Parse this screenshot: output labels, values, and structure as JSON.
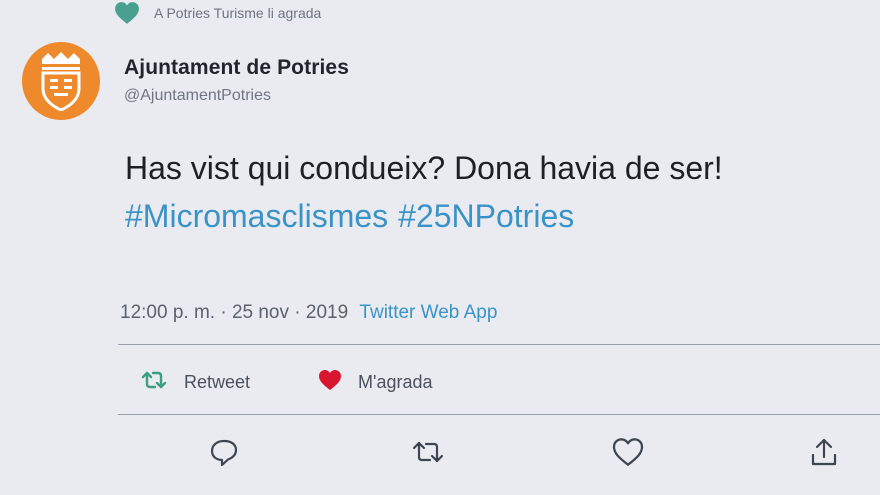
{
  "liked_by": {
    "text": "A Potries Turisme li agrada",
    "icon": "heart-icon",
    "icon_color": "#4aa08f"
  },
  "author": {
    "name": "Ajuntament de Potries",
    "handle": "@AjuntamentPotries",
    "avatar_color": "#ee8a2c"
  },
  "tweet": {
    "text": "Has vist qui condueix? Dona havia de ser!",
    "hashtags": [
      "#Micromasclismes",
      "#25NPotries"
    ],
    "hashtag_color": "#3a93c7"
  },
  "meta": {
    "timestamp": "12:00 p. m. · 25 nov · 2019",
    "source": "Twitter Web App"
  },
  "stats": {
    "retweet_label": "Retweet",
    "like_label": "M'agrada",
    "retweet_color": "#3aa07f",
    "like_color": "#d8162f"
  },
  "actions": [
    {
      "name": "reply",
      "icon": "reply-icon"
    },
    {
      "name": "retweet",
      "icon": "retweet-icon"
    },
    {
      "name": "like",
      "icon": "heart-outline-icon"
    },
    {
      "name": "share",
      "icon": "share-icon"
    }
  ]
}
